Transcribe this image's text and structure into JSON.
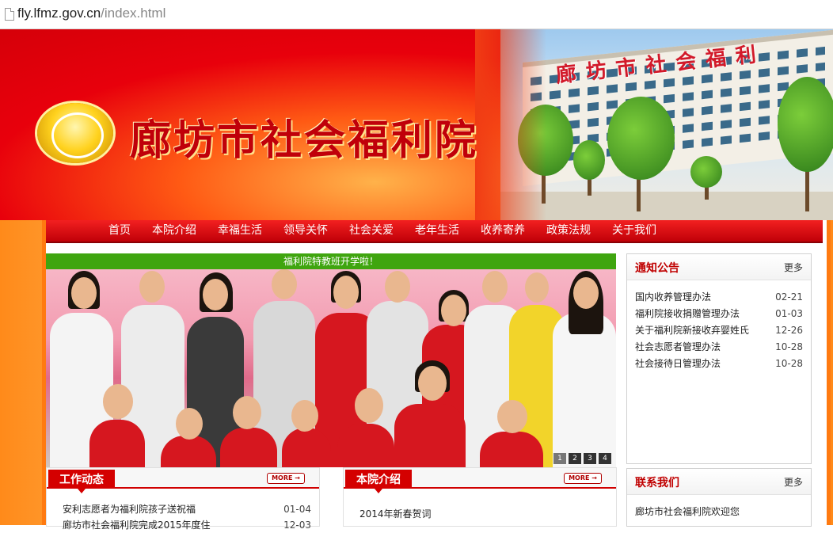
{
  "browser": {
    "url_host": "fly.lfmz.gov.cn",
    "url_path": "/index.html"
  },
  "banner": {
    "title": "廊坊市社会福利院",
    "building_sign": "廊坊市社会福利"
  },
  "nav": {
    "items": [
      "首页",
      "本院介绍",
      "幸福生活",
      "领导关怀",
      "社会关爱",
      "老年生活",
      "收养寄养",
      "政策法规",
      "关于我们"
    ]
  },
  "slideshow": {
    "caption": "福利院特教班开学啦！",
    "pages": [
      "1",
      "2",
      "3",
      "4"
    ]
  },
  "notice": {
    "title": "通知公告",
    "more": "更多",
    "items": [
      {
        "text": "国内收养管理办法",
        "date": "02-21"
      },
      {
        "text": "福利院接收捐赠管理办法",
        "date": "01-03"
      },
      {
        "text": "关于福利院新接收弃婴姓氏",
        "date": "12-26"
      },
      {
        "text": "社会志愿者管理办法",
        "date": "10-28"
      },
      {
        "text": "社会接待日管理办法",
        "date": "10-28"
      }
    ]
  },
  "contact": {
    "title": "联系我们",
    "more": "更多",
    "text": "廊坊市社会福利院欢迎您"
  },
  "work_news": {
    "title": "工作动态",
    "more": "MORE →",
    "items": [
      {
        "text": "安利志愿者为福利院孩子送祝福",
        "date": "01-04"
      },
      {
        "text": "廊坊市社会福利院完成2015年度住",
        "date": "12-03"
      }
    ]
  },
  "intro": {
    "title": "本院介绍",
    "more": "MORE →",
    "items": [
      {
        "text": "2014年新春贺词"
      }
    ]
  },
  "colors": {
    "nav_red": "#d00008",
    "accent_green": "#3fa50f",
    "title_red": "#c00000"
  }
}
